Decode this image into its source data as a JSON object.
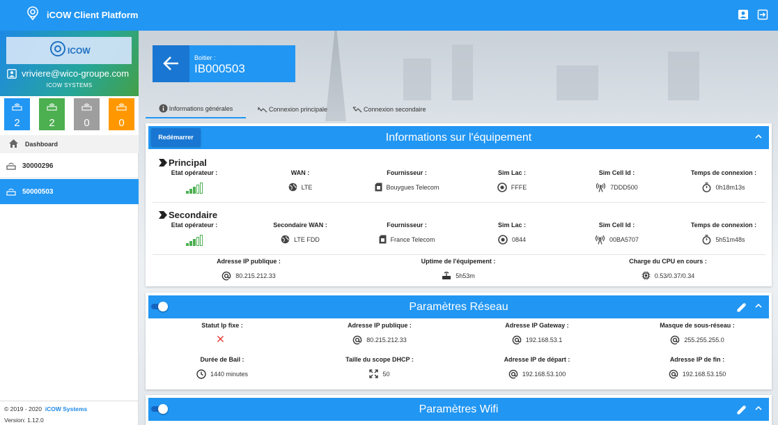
{
  "app": {
    "title": "iCOW Client Platform"
  },
  "user": {
    "brand": "ICOW",
    "email": "vriviere@wico-groupe.com",
    "company": "ICOW SYSTEMS"
  },
  "counters": [
    {
      "value": "2",
      "color": "#2196f3"
    },
    {
      "value": "2",
      "color": "#4caf50"
    },
    {
      "value": "0",
      "color": "#9e9e9e"
    },
    {
      "value": "0",
      "color": "#ff9800"
    }
  ],
  "nav": {
    "dashboard": "Dashboard",
    "items": [
      "30000296",
      "50000503"
    ]
  },
  "footer": {
    "copyright": "© 2019 - 2020",
    "company": "iCOW Systems",
    "version": "Version: 1.12.0"
  },
  "box": {
    "label": "Boitier :",
    "id": "IB000503"
  },
  "tabs": [
    "Informations générales",
    "Connexion principale",
    "Connexion secondaire"
  ],
  "equipment": {
    "title": "Informations sur l'équipement",
    "restart": "Redémarrer",
    "principal": {
      "title": "Principal",
      "fields": [
        {
          "label": "Etat opérateur :",
          "value": ""
        },
        {
          "label": "WAN :",
          "value": "LTE",
          "icon": "globe-icon"
        },
        {
          "label": "Fournisseur :",
          "value": "Bouygues Telecom",
          "icon": "sim-card-icon"
        },
        {
          "label": "Sim Lac :",
          "value": "FFFE",
          "icon": "target-icon"
        },
        {
          "label": "Sim Cell Id :",
          "value": "7DDD500",
          "icon": "antenna-icon"
        },
        {
          "label": "Temps de connexion :",
          "value": "0h18m13s",
          "icon": "timer-icon"
        }
      ]
    },
    "secondaire": {
      "title": "Secondaire",
      "fields": [
        {
          "label": "Etat opérateur :",
          "value": ""
        },
        {
          "label": "Secondaire WAN :",
          "value": "LTE FDD",
          "icon": "globe-icon"
        },
        {
          "label": "Fournisseur :",
          "value": "France Telecom",
          "icon": "sim-card-icon"
        },
        {
          "label": "Sim Lac :",
          "value": "0844",
          "icon": "target-icon"
        },
        {
          "label": "Sim Cell Id :",
          "value": "00BA5707",
          "icon": "antenna-icon"
        },
        {
          "label": "Temps de connexion :",
          "value": "5h51m48s",
          "icon": "timer-icon"
        }
      ]
    },
    "extra": [
      {
        "label": "Adresse IP publique :",
        "value": "80.215.212.33",
        "icon": "at-icon"
      },
      {
        "label": "Uptime de l'équipement :",
        "value": "5h53m",
        "icon": "router-icon"
      },
      {
        "label": "Charge du CPU en cours :",
        "value": "0.53/0.37/0.34",
        "icon": "cpu-icon"
      }
    ]
  },
  "network": {
    "title": "Paramètres Réseau",
    "row1": [
      {
        "label": "Statut Ip fixe :",
        "value": "",
        "icon": "cross-icon"
      },
      {
        "label": "Adresse IP publique :",
        "value": "80.215.212.33",
        "icon": "at-icon"
      },
      {
        "label": "Adresse IP Gateway :",
        "value": "192.168.53.1",
        "icon": "at-icon"
      },
      {
        "label": "Masque de sous-réseau :",
        "value": "255.255.255.0",
        "icon": "at-icon"
      }
    ],
    "row2": [
      {
        "label": "Durée de Bail :",
        "value": "1440 minutes",
        "icon": "clock-icon"
      },
      {
        "label": "Taille du scope DHCP :",
        "value": "50",
        "icon": "expand-icon"
      },
      {
        "label": "Adresse IP de départ :",
        "value": "192.168.53.100",
        "icon": "at-icon"
      },
      {
        "label": "Adresse IP de fin :",
        "value": "192.168.53.150",
        "icon": "at-icon"
      }
    ]
  },
  "wifi": {
    "title": "Paramètres Wifi"
  },
  "colors": {
    "primary": "#2196f3",
    "primary_dark": "#1976d2",
    "signal": "#4caf50",
    "error": "#e53935"
  }
}
